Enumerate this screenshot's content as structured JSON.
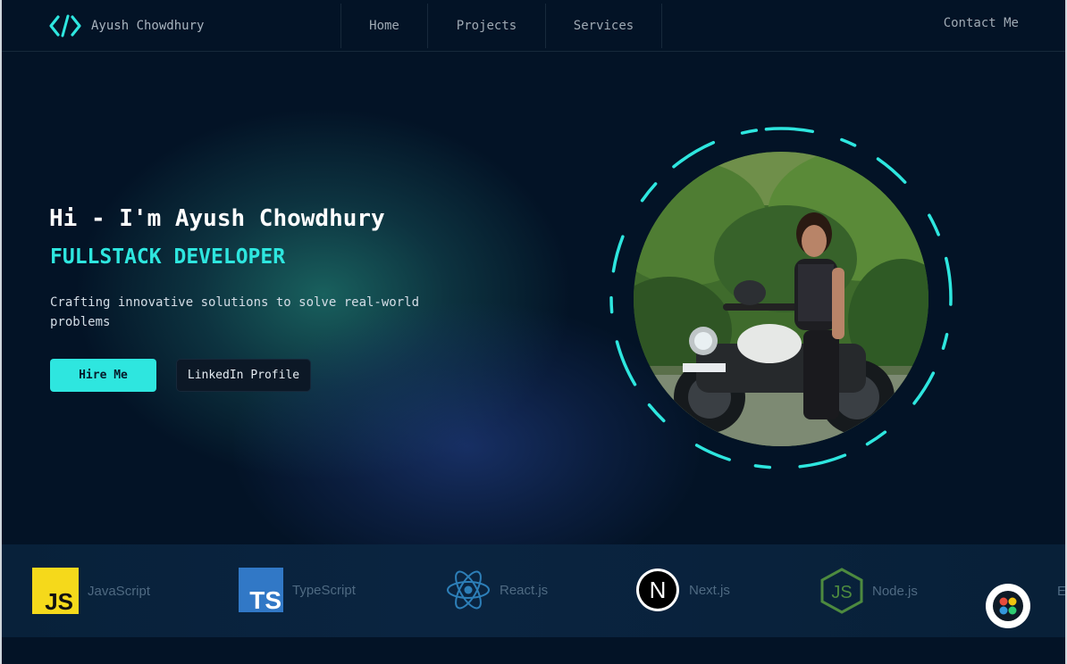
{
  "brand": {
    "name": "Ayush Chowdhury",
    "icon": "code-brackets-icon"
  },
  "nav": {
    "links": [
      {
        "label": "Home"
      },
      {
        "label": "Projects"
      },
      {
        "label": "Services"
      }
    ],
    "contact_label": "Contact Me"
  },
  "hero": {
    "title": "Hi - I'm Ayush Chowdhury",
    "role": "FULLSTACK DEVELOPER",
    "description": "Crafting innovative solutions to solve real-world problems",
    "hire_label": "Hire Me",
    "linkedin_label": "LinkedIn Profile",
    "photo": "profile-photo"
  },
  "skills": [
    {
      "label": "JavaScript",
      "icon": "javascript-logo-icon"
    },
    {
      "label": "TypeScript",
      "icon": "typescript-logo-icon"
    },
    {
      "label": "React.js",
      "icon": "react-logo-icon"
    },
    {
      "label": "Next.js",
      "icon": "nextjs-logo-icon"
    },
    {
      "label": "Node.js",
      "icon": "nodejs-logo-icon"
    },
    {
      "label": "E",
      "icon": ""
    }
  ],
  "colors": {
    "background": "#031326",
    "accent": "#2ee6df",
    "strip": "#0a2440"
  }
}
